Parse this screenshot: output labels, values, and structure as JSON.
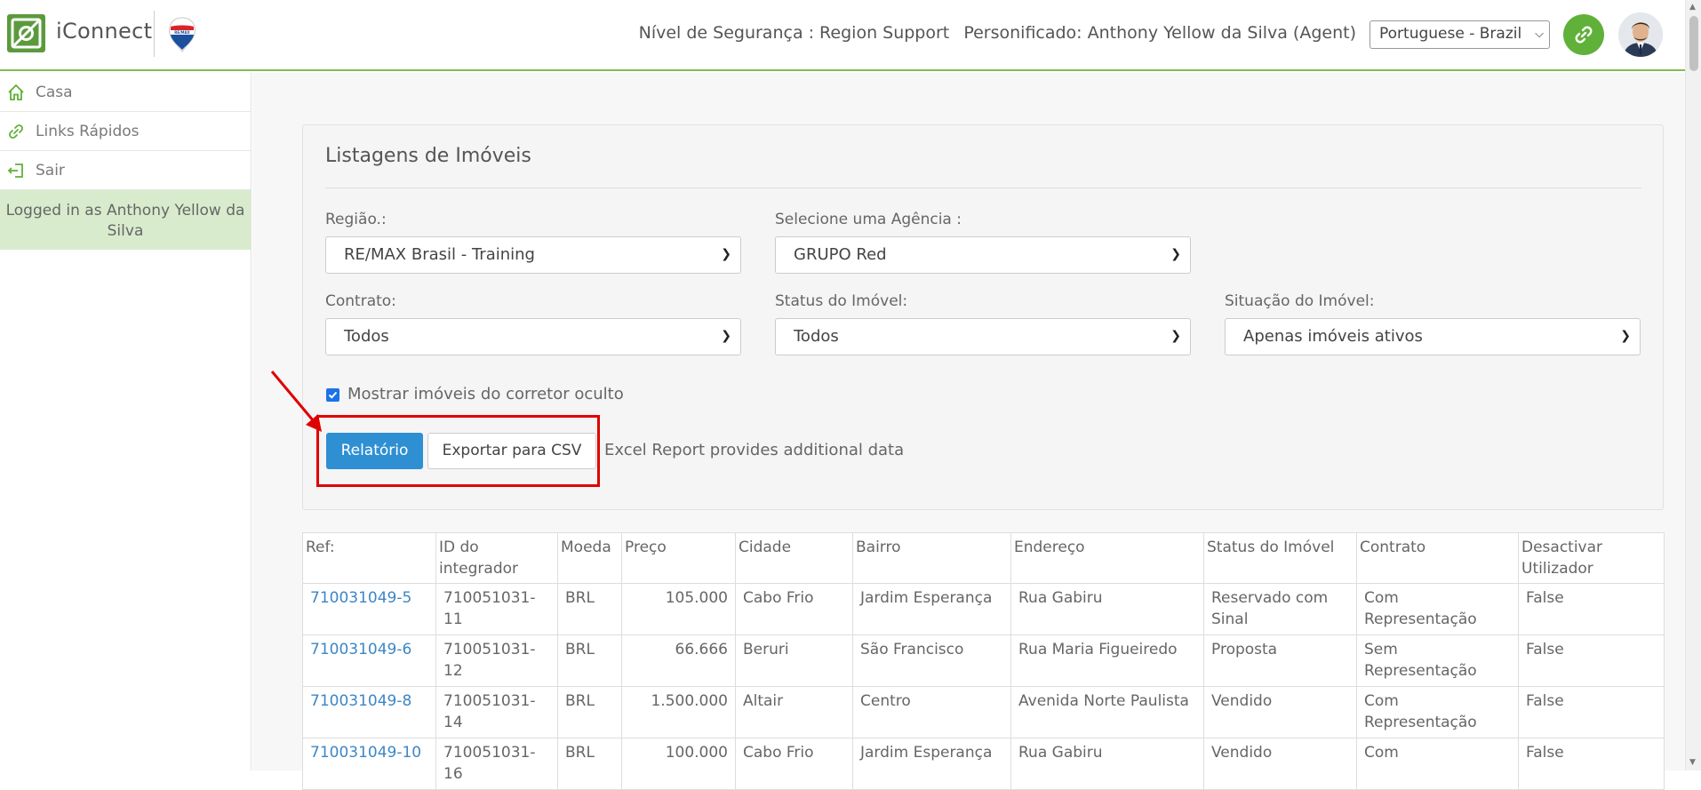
{
  "header": {
    "app_name": "iConnect",
    "security_level": "Nível de Segurança : Region Support",
    "impersonated": "Personificado: Anthony Yellow da Silva (Agent)",
    "language": "Portuguese - Brazil"
  },
  "sidebar": {
    "items": [
      {
        "label": "Casa",
        "icon": "home-icon"
      },
      {
        "label": "Links Rápidos",
        "icon": "link-icon"
      },
      {
        "label": "Sair",
        "icon": "logout-icon"
      }
    ],
    "logged_in": "Logged in as Anthony Yellow da Silva"
  },
  "panel": {
    "title": "Listagens de Imóveis",
    "region_label": "Região.:",
    "region_value": "RE/MAX Brasil - Training",
    "agency_label": "Selecione uma Agência :",
    "agency_value": "GRUPO Red",
    "contract_label": "Contrato:",
    "contract_value": "Todos",
    "status_label": "Status do Imóvel:",
    "status_value": "Todos",
    "situation_label": "Situação do Imóvel:",
    "situation_value": "Apenas imóveis ativos",
    "hidden_agent_label": "Mostrar imóveis do corretor oculto",
    "hidden_agent_checked": true,
    "report_button": "Relatório",
    "export_button": "Exportar para CSV",
    "excel_note": "Excel Report provides additional data"
  },
  "table": {
    "headers": [
      "Ref:",
      "ID do integrador",
      "Moeda",
      "Preço",
      "Cidade",
      "Bairro",
      "Endereço",
      "Status do Imóvel",
      "Contrato",
      "Desactivar Utilizador"
    ],
    "rows": [
      [
        "710031049-5",
        "710051031-11",
        "BRL",
        "105.000",
        "Cabo Frio",
        "Jardim Esperança",
        "Rua Gabiru",
        "Reservado com Sinal",
        "Com Representação",
        "False"
      ],
      [
        "710031049-6",
        "710051031-12",
        "BRL",
        "66.666",
        "Beruri",
        "São Francisco",
        "Rua Maria Figueiredo",
        "Proposta",
        "Sem Representação",
        "False"
      ],
      [
        "710031049-8",
        "710051031-14",
        "BRL",
        "1.500.000",
        "Altair",
        "Centro",
        "Avenida Norte Paulista",
        "Vendido",
        "Com Representação",
        "False"
      ],
      [
        "710031049-10",
        "710051031-16",
        "BRL",
        "100.000",
        "Cabo Frio",
        "Jardim Esperança",
        "Rua Gabiru",
        "Vendido",
        "Com",
        "False"
      ]
    ]
  },
  "colors": {
    "brand_green": "#5fb139",
    "primary_blue": "#2e8fd3",
    "highlight_red": "#e00000",
    "link_blue": "#3d86c6"
  }
}
